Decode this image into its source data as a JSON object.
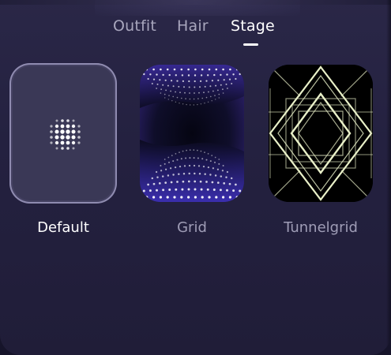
{
  "tabs": [
    {
      "label": "Outfit",
      "active": false
    },
    {
      "label": "Hair",
      "active": false
    },
    {
      "label": "Stage",
      "active": true
    }
  ],
  "stages": [
    {
      "label": "Default",
      "selected": true,
      "icon": "dot-grid-icon"
    },
    {
      "label": "Grid",
      "selected": false,
      "icon": "grid-preview"
    },
    {
      "label": "Tunnelgrid",
      "selected": false,
      "icon": "tunnelgrid-preview"
    }
  ],
  "colors": {
    "panel_background": "#242140",
    "active_text": "#ffffff",
    "inactive_text": "#a8a6bd",
    "selected_border": "#8f8bb0"
  }
}
